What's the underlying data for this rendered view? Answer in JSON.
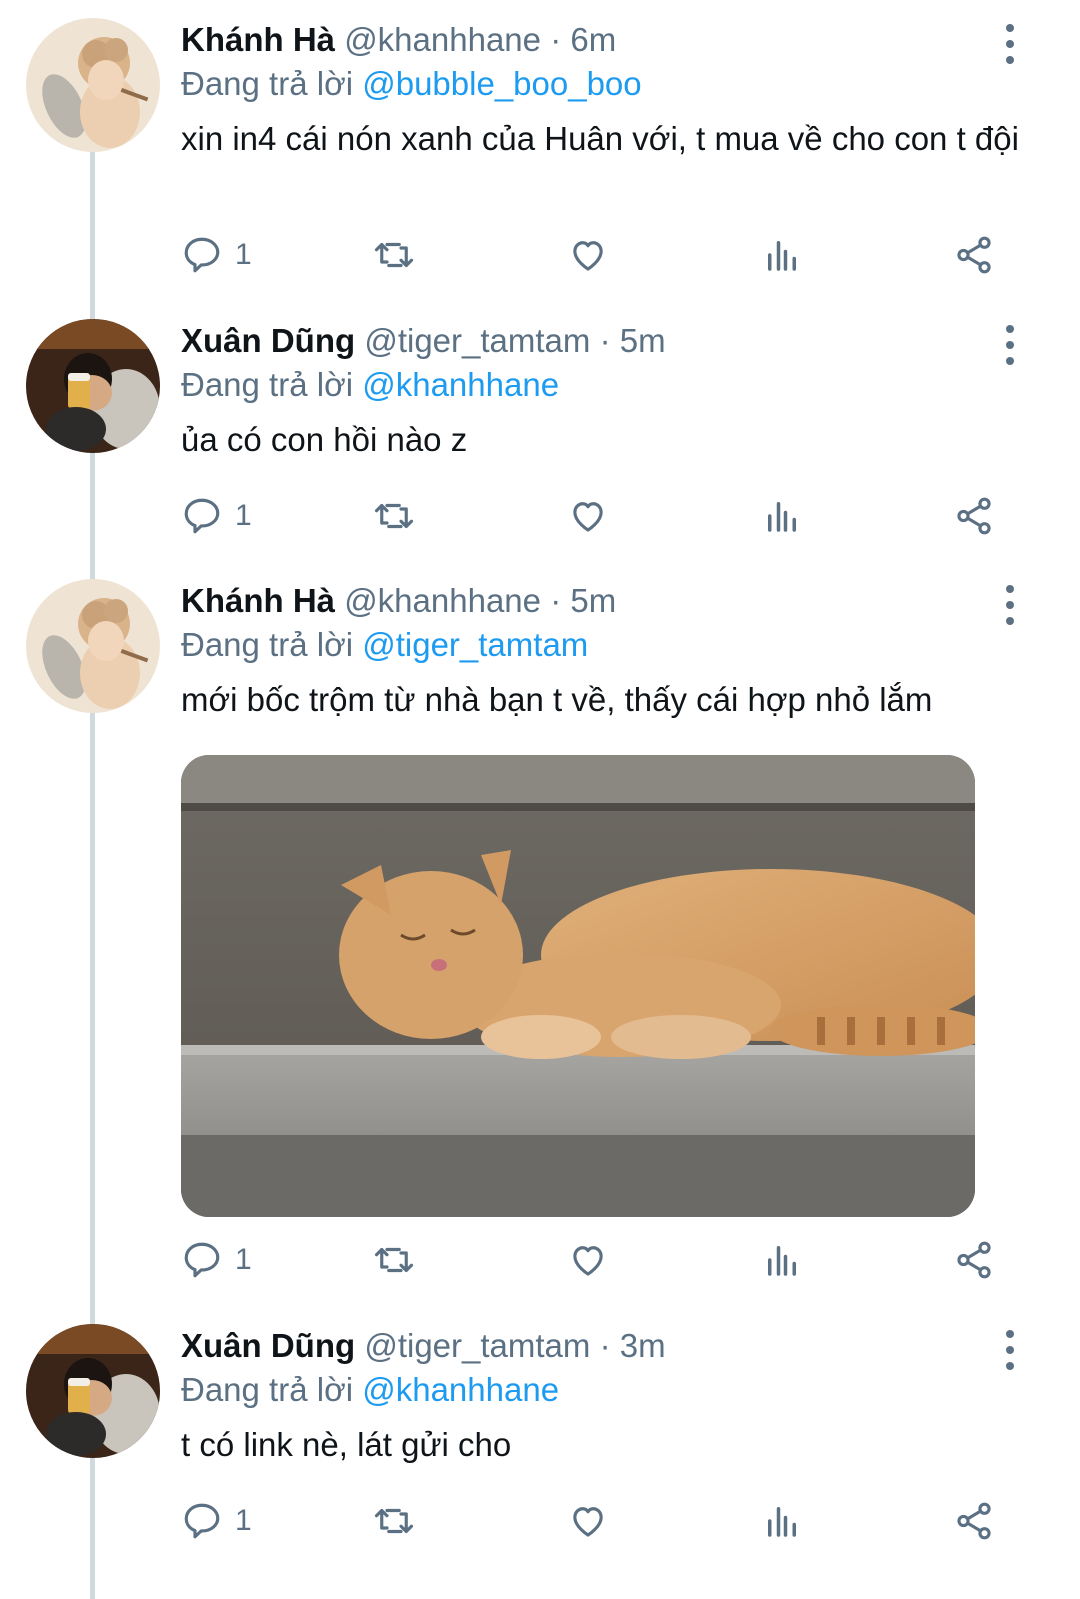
{
  "tweets": [
    {
      "name": "Khánh Hà",
      "handle": "@khanhhane",
      "dot": "·",
      "time": "6m",
      "replying_prefix": "Đang trả lời",
      "replying_to": "@bubble_boo_boo",
      "text": "xin in4 cái nón xanh của Huân với, t mua về cho con t đội",
      "reply_count": "1",
      "avatar": "angel-avatar"
    },
    {
      "name": "Xuân Dũng",
      "handle": "@tiger_tamtam",
      "dot": "·",
      "time": "5m",
      "replying_prefix": "Đang trả lời",
      "replying_to": "@khanhhane",
      "text": "ủa có con hồi nào z",
      "reply_count": "1",
      "avatar": "beer-avatar"
    },
    {
      "name": "Khánh Hà",
      "handle": "@khanhhane",
      "dot": "·",
      "time": "5m",
      "replying_prefix": "Đang trả lời",
      "replying_to": "@tiger_tamtam",
      "text": "mới bốc trộm từ nhà bạn t về, thấy cái hợp nhỏ lắm",
      "reply_count": "1",
      "avatar": "angel-avatar",
      "media": "sleeping-cat-photo"
    },
    {
      "name": "Xuân Dũng",
      "handle": "@tiger_tamtam",
      "dot": "·",
      "time": "3m",
      "replying_prefix": "Đang trả lời",
      "replying_to": "@khanhhane",
      "text": "t có link nè, lát gửi cho",
      "reply_count": "1",
      "avatar": "beer-avatar"
    }
  ],
  "icons": {
    "reply": "reply-icon",
    "retweet": "retweet-icon",
    "like": "heart-icon",
    "analytics": "analytics-icon",
    "share": "share-icon",
    "more": "more-icon"
  },
  "colors": {
    "link": "#1d9bf0",
    "muted": "#5b7083",
    "text": "#0f1419",
    "thread_line": "#cfd9de"
  }
}
